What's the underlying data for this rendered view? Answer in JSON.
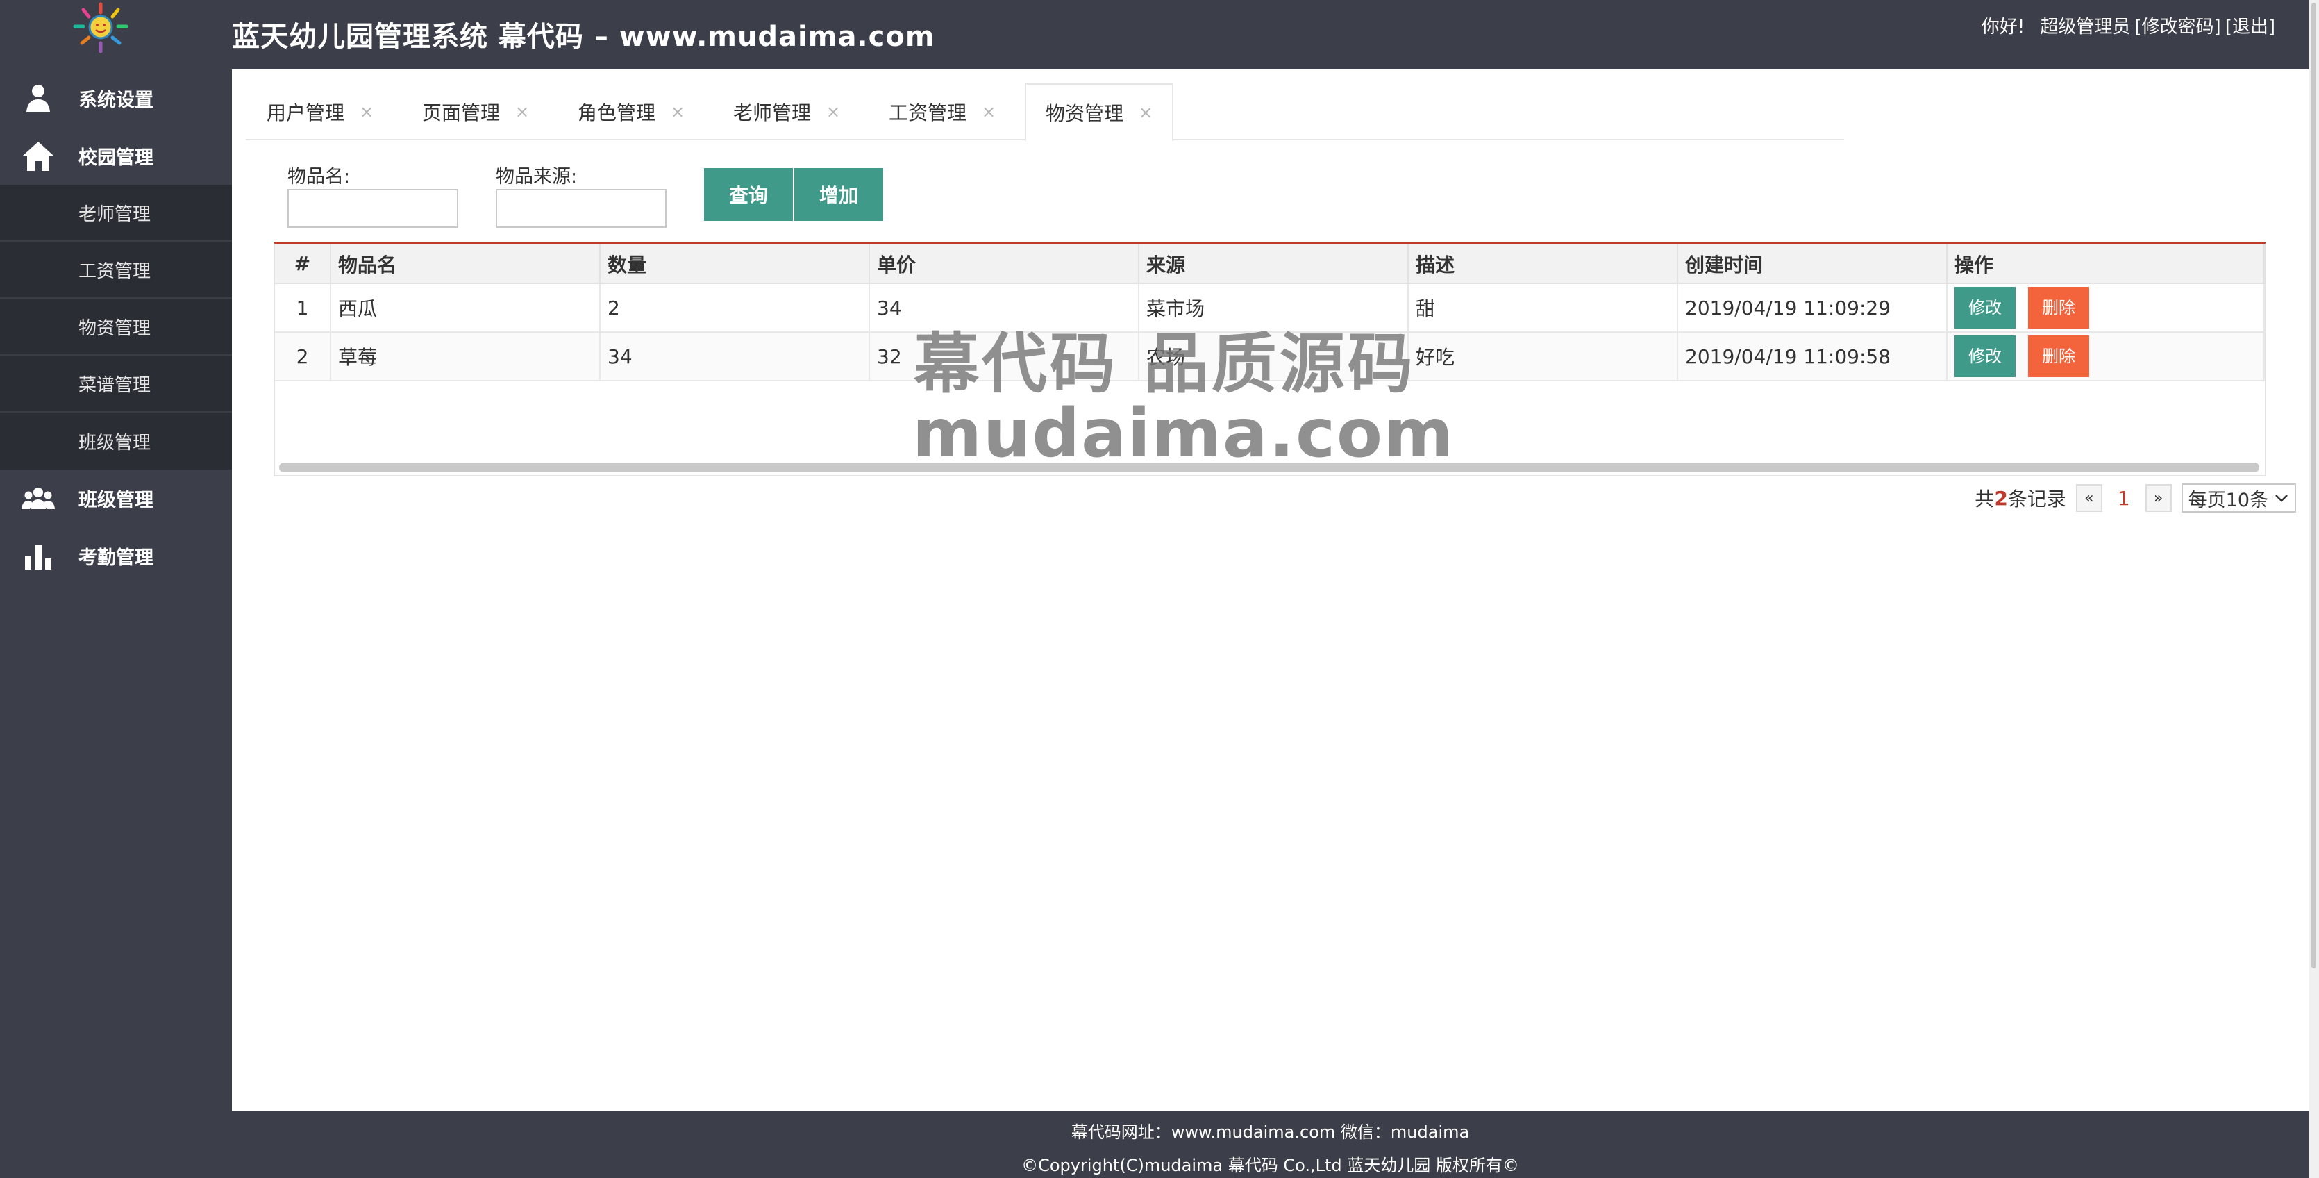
{
  "header": {
    "title": "蓝天幼儿园管理系统 幕代码 – www.mudaima.com",
    "greeting": "你好!",
    "user": "超级管理员",
    "change_password": "[修改密码]",
    "logout": "[退出]"
  },
  "sidebar": {
    "items": [
      {
        "label": "系统设置",
        "icon": "user-icon"
      },
      {
        "label": "校园管理",
        "icon": "home-icon"
      },
      {
        "label": "班级管理",
        "icon": "group-icon"
      },
      {
        "label": "考勤管理",
        "icon": "bar-chart-icon"
      }
    ],
    "sub_items": [
      "老师管理",
      "工资管理",
      "物资管理",
      "菜谱管理",
      "班级管理"
    ]
  },
  "tabs": [
    {
      "label": "用户管理",
      "close": "×"
    },
    {
      "label": "页面管理",
      "close": "×"
    },
    {
      "label": "角色管理",
      "close": "×"
    },
    {
      "label": "老师管理",
      "close": "×"
    },
    {
      "label": "工资管理",
      "close": "×"
    },
    {
      "label": "物资管理",
      "close": "×"
    }
  ],
  "search": {
    "name_label": "物品名:",
    "name_value": "",
    "source_label": "物品来源:",
    "source_value": "",
    "query_button": "查询",
    "add_button": "增加"
  },
  "table": {
    "columns": [
      "#",
      "物品名",
      "数量",
      "单价",
      "来源",
      "描述",
      "创建时间",
      "操作"
    ],
    "rows": [
      {
        "no": "1",
        "name": "西瓜",
        "qty": "2",
        "price": "34",
        "source": "菜市场",
        "desc": "甜",
        "created": "2019/04/19 11:09:29"
      },
      {
        "no": "2",
        "name": "草莓",
        "qty": "34",
        "price": "32",
        "source": "农场",
        "desc": "好吃",
        "created": "2019/04/19 11:09:58"
      }
    ],
    "edit_label": "修改",
    "delete_label": "删除"
  },
  "pagination": {
    "prefix": "共",
    "count": "2",
    "suffix": "条记录",
    "prev": "«",
    "current": "1",
    "next": "»",
    "per_page": "每页10条"
  },
  "watermark": {
    "line1": "幕代码 品质源码",
    "line2": "mudaima.com"
  },
  "footer": {
    "line1": "幕代码网址：www.mudaima.com 微信：mudaima",
    "line2": "©Copyright(C)mudaima 幕代码 Co.,Ltd 蓝天幼儿园 版权所有©"
  },
  "colors": {
    "chrome": "#3c3f4a",
    "submenu": "#2b2d35",
    "accent_green": "#3f9a8a",
    "danger_orange": "#f3643c",
    "table_top_border": "#c1392b"
  }
}
